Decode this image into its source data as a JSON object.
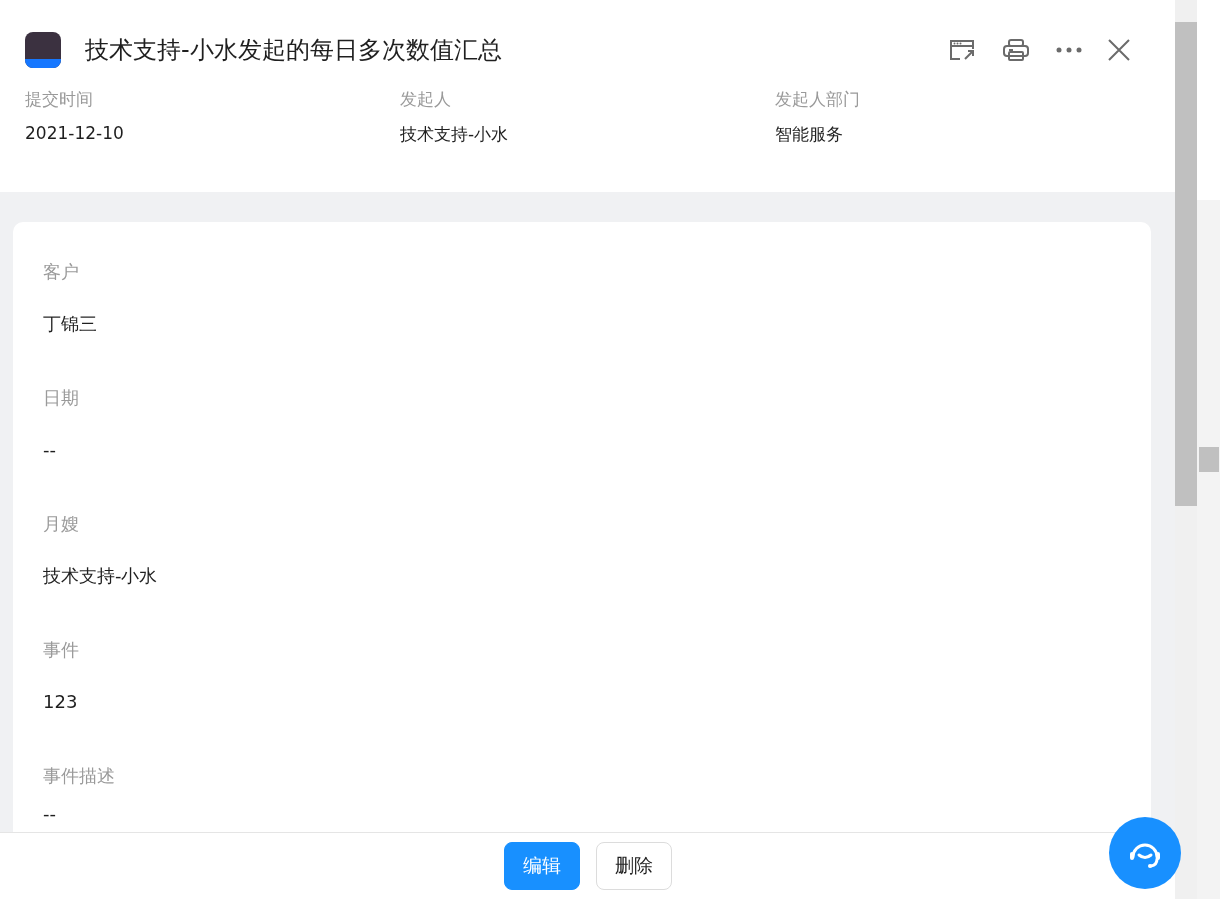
{
  "header": {
    "title": "技术支持-小水发起的每日多次数值汇总",
    "meta": [
      {
        "label": "提交时间",
        "value": "2021-12-10"
      },
      {
        "label": "发起人",
        "value": "技术支持-小水"
      },
      {
        "label": "发起人部门",
        "value": "智能服务"
      }
    ]
  },
  "fields": [
    {
      "label": "客户",
      "value": "丁锦三"
    },
    {
      "label": "日期",
      "value": "--"
    },
    {
      "label": "月嫂",
      "value": "技术支持-小水"
    },
    {
      "label": "事件",
      "value": "123"
    },
    {
      "label": "事件描述",
      "value": "--"
    }
  ],
  "footer": {
    "buttons": [
      {
        "label": "编辑",
        "kind": "primary"
      },
      {
        "label": "删除",
        "kind": "default"
      }
    ]
  }
}
